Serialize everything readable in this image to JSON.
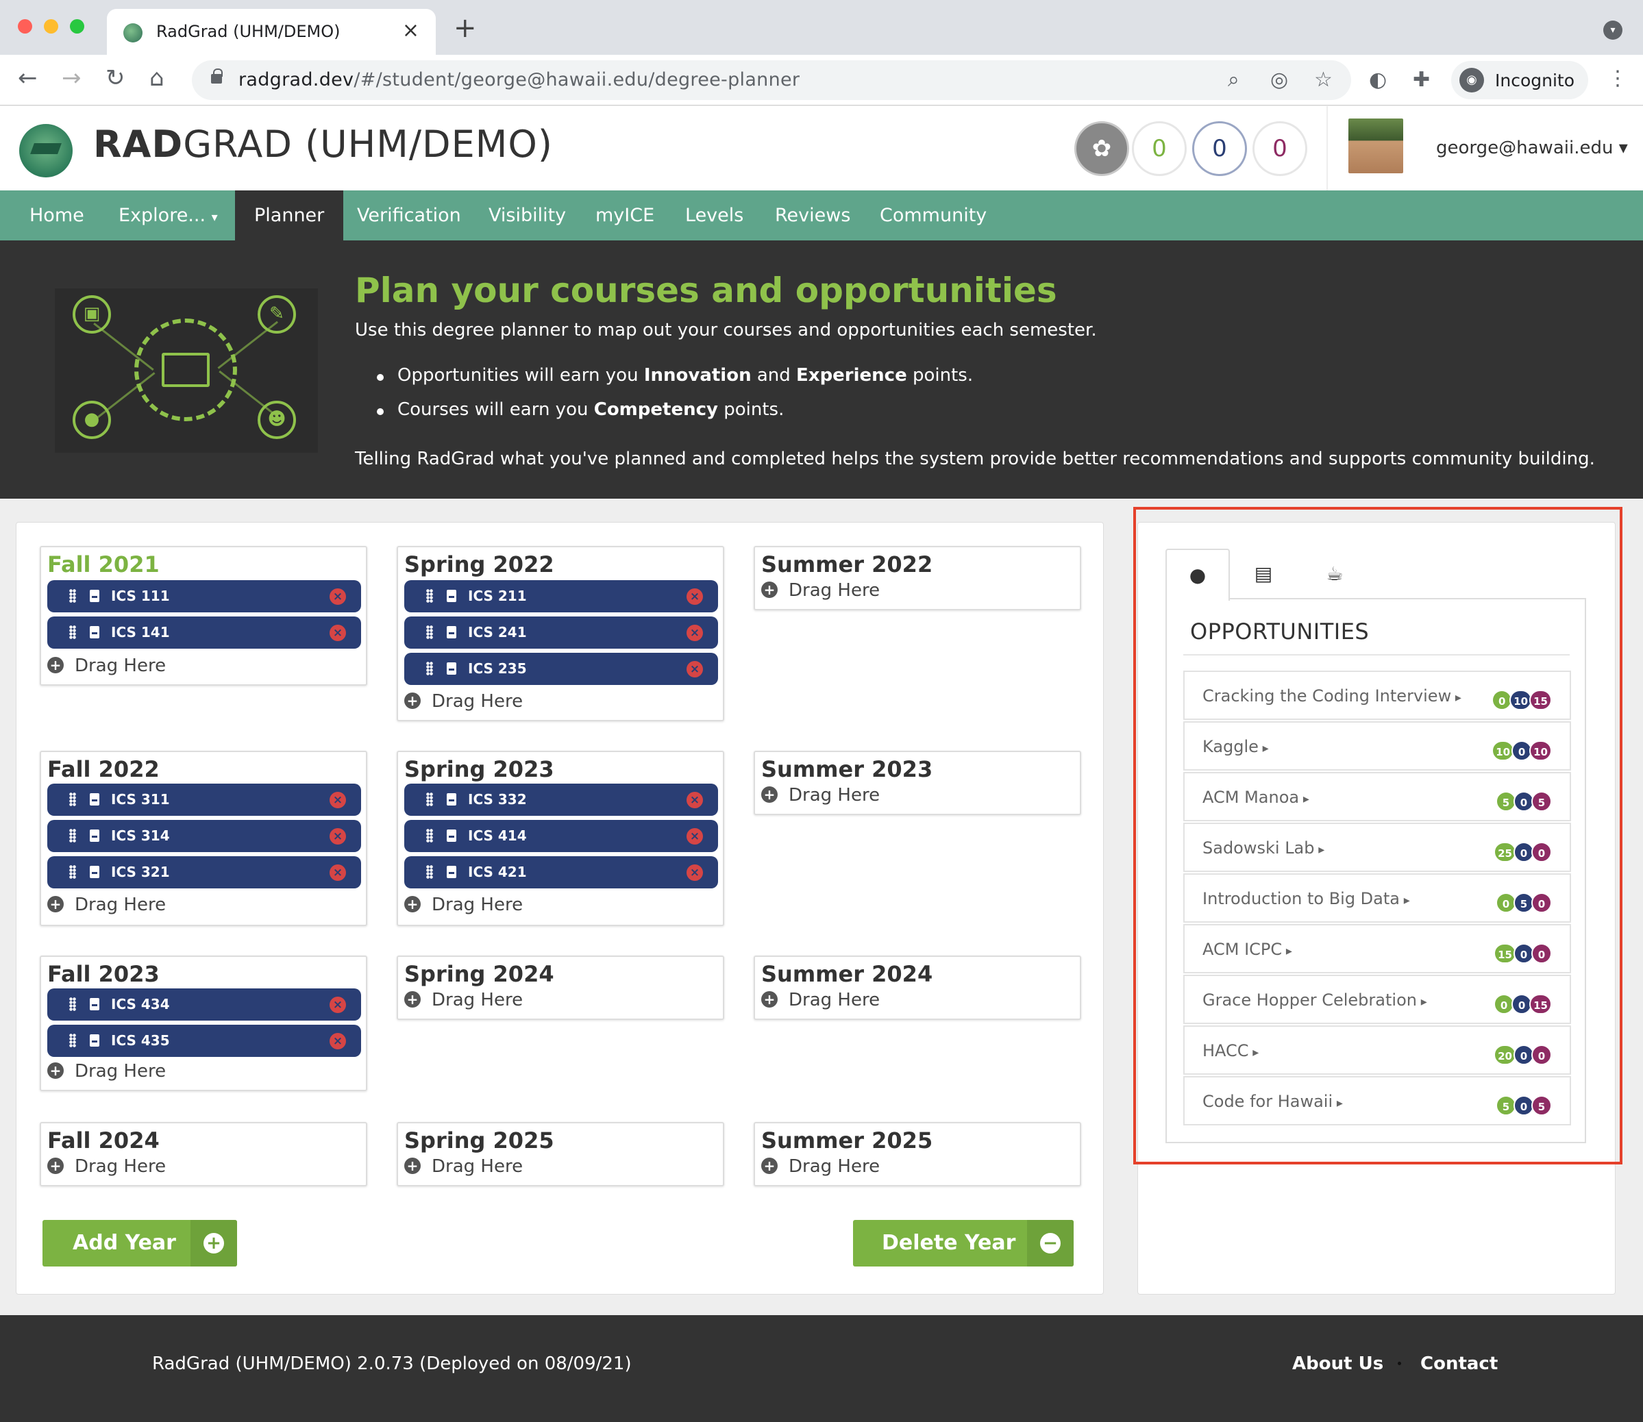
{
  "browser": {
    "tab_title": "RadGrad (UHM/DEMO)",
    "url_host": "radgrad.dev",
    "url_path": "/#/student/george@hawaii.edu/degree-planner",
    "profile_label": "Incognito"
  },
  "header": {
    "brand_bold": "RAD",
    "brand_rest": "GRAD (UHM/DEMO)",
    "ice_scores": {
      "innovation": "0",
      "competency": "0",
      "experience": "0"
    },
    "user_email": "george@hawaii.edu"
  },
  "nav": {
    "items": [
      "Home",
      "Explore...",
      "Planner",
      "Verification",
      "Visibility",
      "myICE",
      "Levels",
      "Reviews",
      "Community"
    ],
    "active": "Planner"
  },
  "banner": {
    "title": "Plan your courses and opportunities",
    "subtitle": "Use this degree planner to map out your courses and opportunities each semester.",
    "bullet1": {
      "pre": "Opportunities will earn you ",
      "b1": "Innovation",
      "mid": " and ",
      "b2": "Experience",
      "post": " points."
    },
    "bullet2": {
      "pre": "Courses will earn you ",
      "b1": "Competency",
      "post": " points."
    },
    "footer": "Telling RadGrad what you've planned and completed helps the system provide better recommendations and supports community building."
  },
  "planner": {
    "drag_label": "Drag Here",
    "semesters": [
      {
        "name": "Fall 2021",
        "current": true,
        "courses": [
          "ICS 111",
          "ICS 141"
        ]
      },
      {
        "name": "Spring 2022",
        "courses": [
          "ICS 211",
          "ICS 241",
          "ICS 235"
        ]
      },
      {
        "name": "Summer 2022",
        "courses": []
      },
      {
        "name": "Fall 2022",
        "courses": [
          "ICS 311",
          "ICS 314",
          "ICS 321"
        ]
      },
      {
        "name": "Spring 2023",
        "courses": [
          "ICS 332",
          "ICS 414",
          "ICS 421"
        ]
      },
      {
        "name": "Summer 2023",
        "courses": []
      },
      {
        "name": "Fall 2023",
        "courses": [
          "ICS 434",
          "ICS 435"
        ]
      },
      {
        "name": "Spring 2024",
        "courses": []
      },
      {
        "name": "Summer 2024",
        "courses": []
      },
      {
        "name": "Fall 2024",
        "courses": []
      },
      {
        "name": "Spring 2025",
        "courses": []
      },
      {
        "name": "Summer 2025",
        "courses": []
      }
    ],
    "add_year_label": "Add Year",
    "delete_year_label": "Delete Year"
  },
  "panel": {
    "tabs": [
      "lightbulb-icon",
      "book-icon",
      "coffee-icon"
    ],
    "title": "OPPORTUNITIES",
    "opportunities": [
      {
        "name": "Cracking the Coding Interview",
        "i": "0",
        "c": "10",
        "e": "15"
      },
      {
        "name": "Kaggle",
        "i": "10",
        "c": "0",
        "e": "10"
      },
      {
        "name": "ACM Manoa",
        "i": "5",
        "c": "0",
        "e": "5"
      },
      {
        "name": "Sadowski Lab",
        "i": "25",
        "c": "0",
        "e": "0"
      },
      {
        "name": "Introduction to Big Data",
        "i": "0",
        "c": "5",
        "e": "0"
      },
      {
        "name": "ACM ICPC",
        "i": "15",
        "c": "0",
        "e": "0"
      },
      {
        "name": "Grace Hopper Celebration",
        "i": "0",
        "c": "0",
        "e": "15"
      },
      {
        "name": "HACC",
        "i": "20",
        "c": "0",
        "e": "0"
      },
      {
        "name": "Code for Hawaii",
        "i": "5",
        "c": "0",
        "e": "5"
      }
    ]
  },
  "footer": {
    "version_text": "RadGrad (UHM/DEMO) 2.0.73 (Deployed on 08/09/21)",
    "about_label": "About Us",
    "contact_label": "Contact"
  },
  "colors": {
    "nav_green": "#5fa58b",
    "accent_green": "#7cb342",
    "course_navy": "#2a3e74",
    "experience_maroon": "#8e2b63",
    "highlight_red": "#e5412b"
  }
}
